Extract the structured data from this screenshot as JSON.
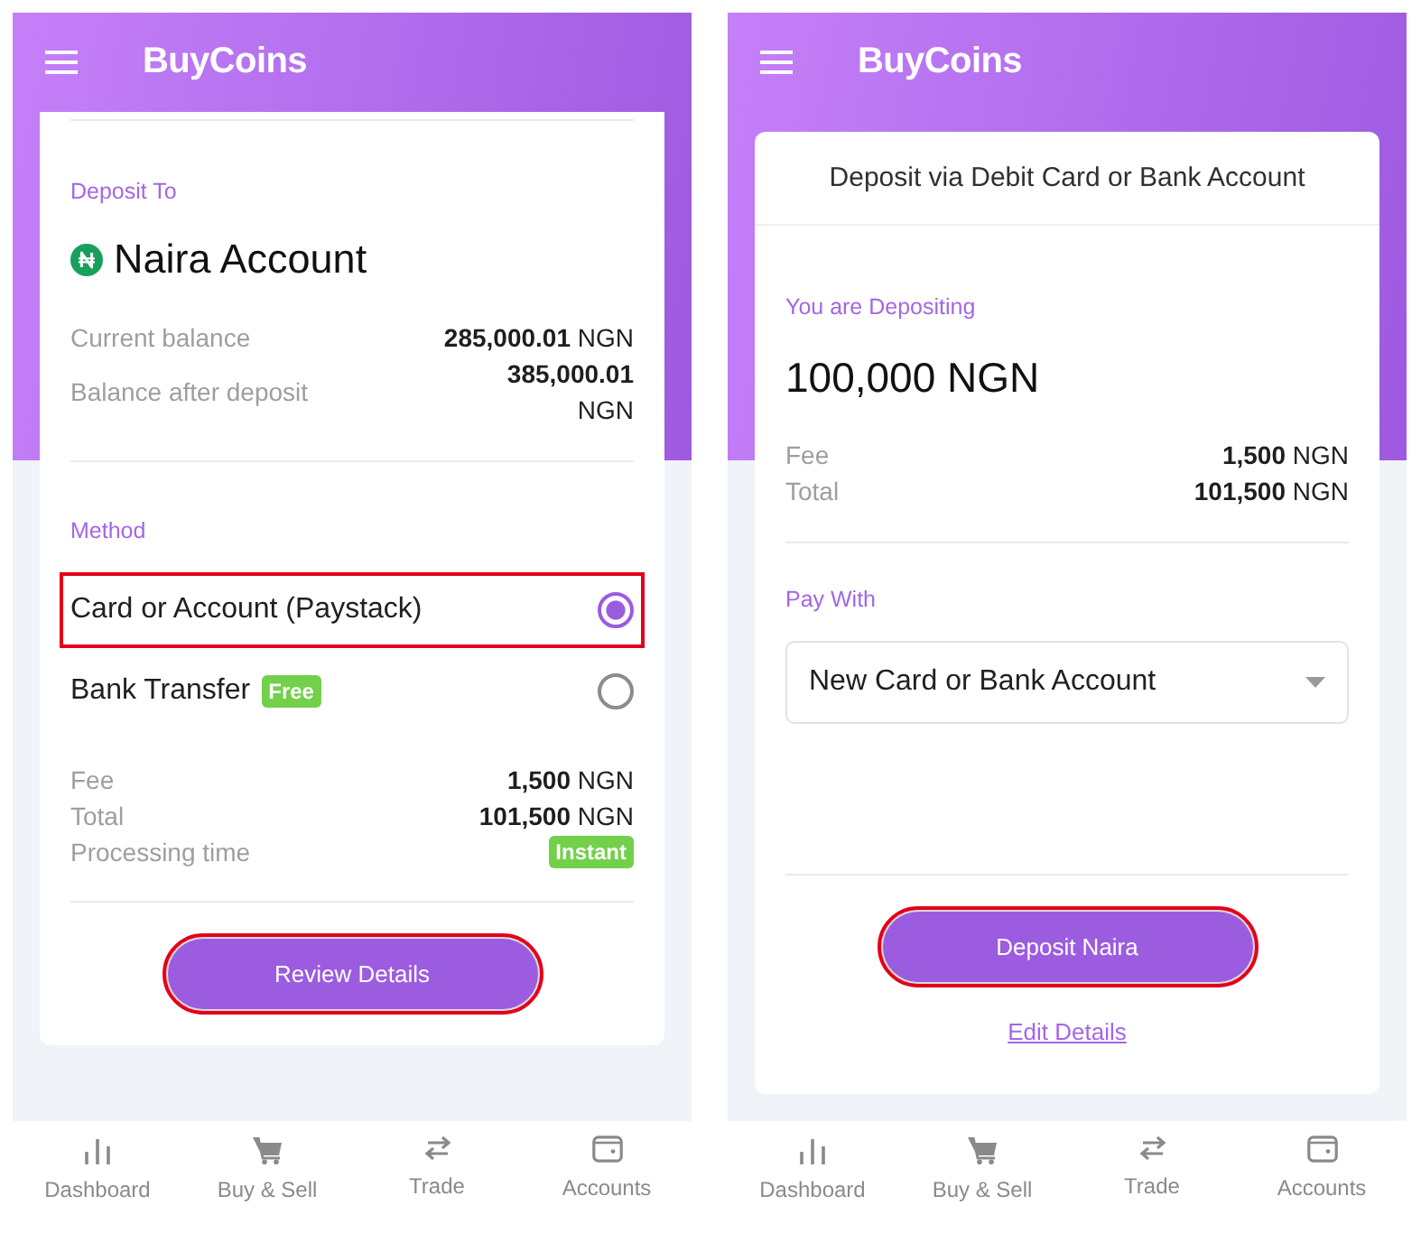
{
  "screens": [
    {
      "top_bar": {
        "logo": "BuyCoins"
      },
      "card": {
        "sections": [
          {
            "kind": "account",
            "label": "Deposit To",
            "account": "Naira Account",
            "rows": [
              {
                "kind": "amount",
                "label": "Current balance",
                "value": "**285,000.01** NGN"
              },
              {
                "kind": "amount",
                "label": "Balance after deposit",
                "value": "**385,000.01** NGN"
              }
            ]
          },
          {
            "kind": "methods",
            "label": "Method",
            "options": [
              {
                "label": "Card or Account (Paystack)",
                "selected": true,
                "highlighted": true
              },
              {
                "label": "Bank Transfer",
                "badge": "Free",
                "selected": false,
                "highlighted": false
              }
            ],
            "rows": [
              {
                "kind": "amount",
                "label": "Fee",
                "value": "**1,500** NGN"
              },
              {
                "kind": "amount",
                "label": "Total",
                "value": "**101,500** NGN"
              },
              {
                "kind": "badge",
                "label": "Processing time",
                "value": "Instant"
              }
            ]
          },
          {
            "kind": "actions",
            "button": {
              "label": "Review Details",
              "highlighted": true
            }
          }
        ]
      },
      "bottom_nav": [
        {
          "label": "Dashboard",
          "selected": false
        },
        {
          "label": "Buy & Sell",
          "selected": false
        },
        {
          "label": "Trade",
          "selected": false
        },
        {
          "label": "Accounts",
          "selected": false
        }
      ]
    },
    {
      "top_bar": {
        "logo": "BuyCoins"
      },
      "card": {
        "title": "Deposit via Debit Card or Bank Account",
        "sections": [
          {
            "kind": "amount",
            "label": "You are Depositing",
            "amount": "100,000 NGN",
            "rows": [
              {
                "kind": "amount",
                "label": "Fee",
                "value": "**1,500** NGN"
              },
              {
                "kind": "amount",
                "label": "Total",
                "value": "**101,500** NGN"
              }
            ]
          },
          {
            "kind": "payment",
            "label": "Pay With",
            "select": {
              "value": "New Card or Bank Account"
            }
          },
          {
            "kind": "actions",
            "button": {
              "label": "Deposit Naira",
              "highlighted": true
            },
            "link": "Edit Details"
          }
        ]
      },
      "bottom_nav": [
        {
          "label": "Dashboard",
          "selected": false
        },
        {
          "label": "Buy & Sell",
          "selected": false
        },
        {
          "label": "Trade",
          "selected": false
        },
        {
          "label": "Accounts",
          "selected": false
        }
      ]
    }
  ]
}
